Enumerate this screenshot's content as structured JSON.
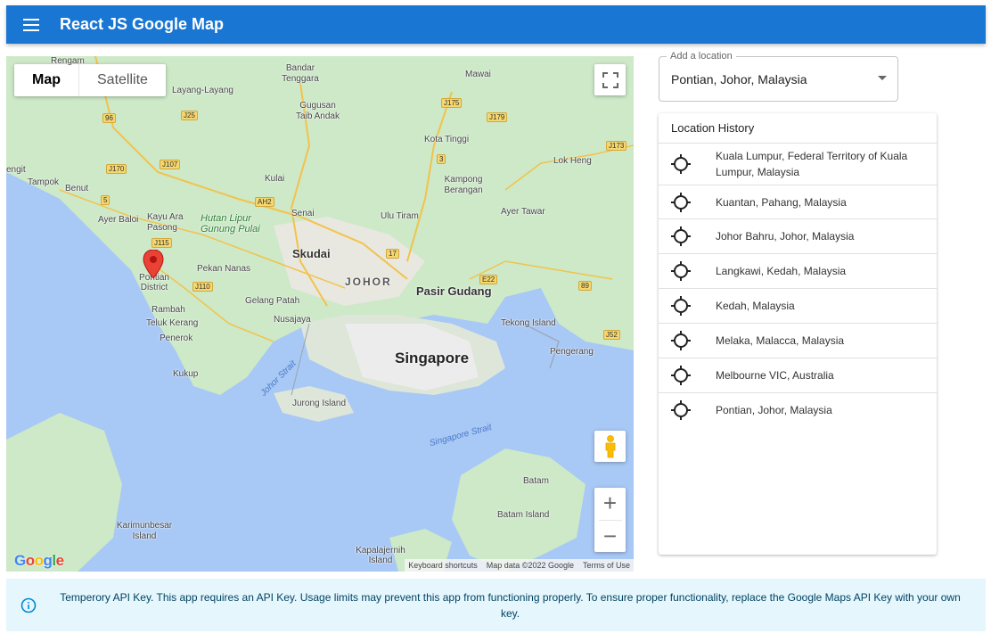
{
  "appbar": {
    "title": "React JS Google Map",
    "menu_icon": "menu-icon"
  },
  "map": {
    "map_types": {
      "map": "Map",
      "satellite": "Satellite",
      "selected": "Map"
    },
    "labels": {
      "cities": [
        "Skudai",
        "Pasir Gudang",
        "Pontian District"
      ],
      "big_city": "Singapore",
      "region": "JOHOR",
      "towns": [
        "Rengam",
        "Bandar Tenggara",
        "Gugusan Taib Andak",
        "Mawai",
        "Layang-Layang",
        "Kota Tinggi",
        "Lok Heng",
        "Kampong Berangan",
        "Kulai",
        "Senai",
        "Ulu Tiram",
        "Ayer Tawar",
        "Tampok",
        "Benut",
        "Ayer Baloi",
        "Kayu Ara Pasong",
        "Pekan Nanas",
        "Gelang Patah",
        "Nusajaya",
        "Rambah",
        "Teluk Kerang",
        "Penerok",
        "Kukup",
        "Jurong Island",
        "Tekong Island",
        "Pengerang",
        "Batam",
        "Batam Island",
        "Karimunbesar Island",
        "Kapalajernih Island",
        "engit"
      ],
      "park": "Hutan Lipur Gunung Pulai",
      "waters": [
        "Johor Strait",
        "Singapore Strait"
      ],
      "shields": [
        "96",
        "J25",
        "J170",
        "J107",
        "J175",
        "J179",
        "J173",
        "3",
        "5",
        "AH2",
        "J115",
        "J110",
        "17",
        "E22",
        "89",
        "J52"
      ]
    },
    "google_logo": "Google",
    "attribution": {
      "shortcuts": "Keyboard shortcuts",
      "data": "Map data ©2022 Google",
      "terms": "Terms of Use"
    },
    "zoom": {
      "in": "+",
      "out": "−"
    }
  },
  "location_select": {
    "label": "Add a location",
    "value": "Pontian, Johor, Malaysia"
  },
  "history": {
    "title": "Location History",
    "items": [
      {
        "label": "Kuala Lumpur, Federal Territory of Kuala Lumpur, Malaysia"
      },
      {
        "label": "Kuantan, Pahang, Malaysia"
      },
      {
        "label": "Johor Bahru, Johor, Malaysia"
      },
      {
        "label": "Langkawi, Kedah, Malaysia"
      },
      {
        "label": "Kedah, Malaysia"
      },
      {
        "label": "Melaka, Malacca, Malaysia"
      },
      {
        "label": "Melbourne VIC, Australia"
      },
      {
        "label": "Pontian, Johor, Malaysia"
      }
    ]
  },
  "alert": {
    "text": "Temperory API Key. This app requires an API Key. Usage limits may prevent this app from functioning properly. To ensure proper functionality, replace the Google Maps API Key with your own key.",
    "color": "#e5f6fd"
  },
  "colors": {
    "appbar": "#1976d2",
    "land": "#cde9c8",
    "water": "#a8c8f5",
    "marker": "#ea4335"
  }
}
